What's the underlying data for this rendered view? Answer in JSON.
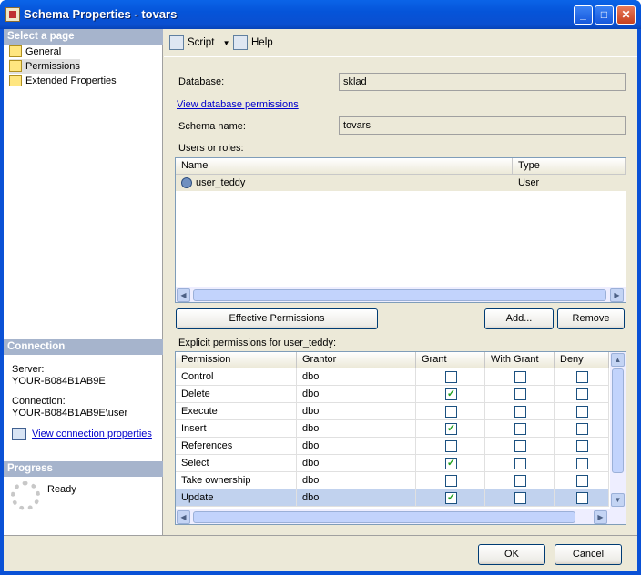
{
  "window": {
    "title": "Schema Properties - tovars"
  },
  "left": {
    "select_page_header": "Select a page",
    "pages": [
      {
        "label": "General"
      },
      {
        "label": "Permissions"
      },
      {
        "label": "Extended Properties"
      }
    ],
    "connection_header": "Connection",
    "server_label": "Server:",
    "server_value": "YOUR-B084B1AB9E",
    "connection_label": "Connection:",
    "connection_value": "YOUR-B084B1AB9E\\user",
    "view_connection_link": "View connection properties",
    "progress_header": "Progress",
    "progress_status": "Ready"
  },
  "toolbar": {
    "script_label": "Script",
    "help_label": "Help"
  },
  "form": {
    "database_label": "Database:",
    "database_value": "sklad",
    "view_db_permissions_link": "View database permissions",
    "schema_name_label": "Schema name:",
    "schema_name_value": "tovars",
    "users_or_roles_label": "Users or roles:"
  },
  "users_table": {
    "columns": [
      "Name",
      "Type"
    ],
    "rows": [
      {
        "name": "user_teddy",
        "type": "User"
      }
    ]
  },
  "buttons": {
    "effective_permissions": "Effective Permissions",
    "add": "Add...",
    "remove": "Remove",
    "ok": "OK",
    "cancel": "Cancel"
  },
  "permissions": {
    "label": "Explicit permissions for user_teddy:",
    "columns": [
      "Permission",
      "Grantor",
      "Grant",
      "With Grant",
      "Deny"
    ],
    "rows": [
      {
        "permission": "Control",
        "grantor": "dbo",
        "grant": false,
        "with_grant": false,
        "deny": false
      },
      {
        "permission": "Delete",
        "grantor": "dbo",
        "grant": true,
        "with_grant": false,
        "deny": false
      },
      {
        "permission": "Execute",
        "grantor": "dbo",
        "grant": false,
        "with_grant": false,
        "deny": false
      },
      {
        "permission": "Insert",
        "grantor": "dbo",
        "grant": true,
        "with_grant": false,
        "deny": false
      },
      {
        "permission": "References",
        "grantor": "dbo",
        "grant": false,
        "with_grant": false,
        "deny": false
      },
      {
        "permission": "Select",
        "grantor": "dbo",
        "grant": true,
        "with_grant": false,
        "deny": false
      },
      {
        "permission": "Take ownership",
        "grantor": "dbo",
        "grant": false,
        "with_grant": false,
        "deny": false
      },
      {
        "permission": "Update",
        "grantor": "dbo",
        "grant": true,
        "with_grant": false,
        "deny": false
      }
    ]
  }
}
